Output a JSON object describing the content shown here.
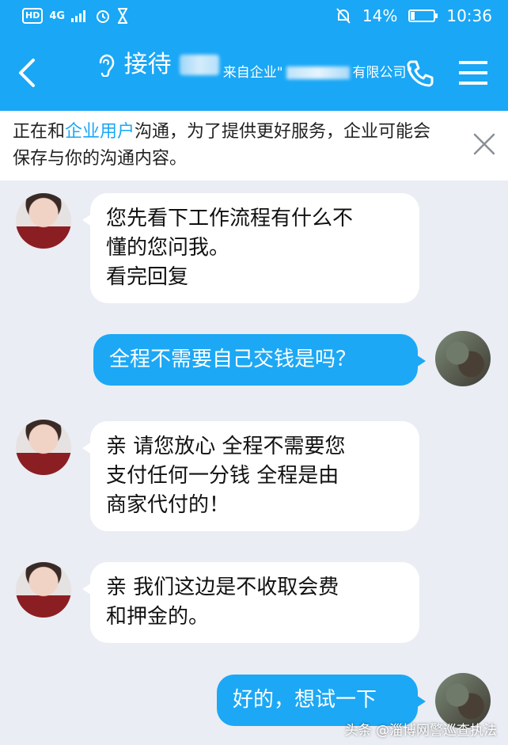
{
  "status_bar": {
    "hd": "HD",
    "network": "4G",
    "battery_percent": "14%",
    "battery_level": 0.14,
    "time": "10:36"
  },
  "header": {
    "title": "接待",
    "subtitle_prefix": "来自企业\"",
    "subtitle_suffix": "有限公司\""
  },
  "notice": {
    "before_link": "正在和",
    "link_text": "企业用户",
    "after_link": "沟通，为了提供更好服务，企业可能会保存与你的沟通内容。"
  },
  "messages": [
    {
      "sender": "agent",
      "lines": [
        "您先看下工作流程有什么不",
        "懂的您问我。",
        "看完回复"
      ]
    },
    {
      "sender": "user",
      "lines": [
        "全程不需要自己交钱是吗？"
      ]
    },
    {
      "sender": "agent",
      "lines": [
        "亲 请您放心  全程不需要您",
        "支付任何一分钱  全程是由",
        "商家代付的！"
      ]
    },
    {
      "sender": "agent",
      "lines": [
        "亲 我们这边是不收取会费",
        "和押金的。"
      ]
    },
    {
      "sender": "user",
      "lines": [
        "好的，想试一下"
      ]
    }
  ],
  "watermark": "头条 @淄博网警巡查执法",
  "colors": {
    "accent": "#1aa7f5",
    "chat_bg": "#eaedf4"
  }
}
